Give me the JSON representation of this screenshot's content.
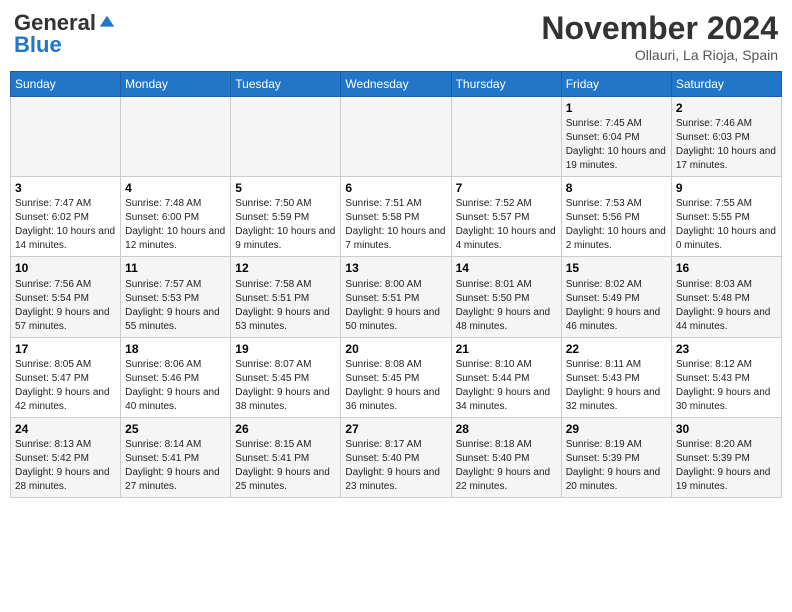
{
  "header": {
    "logo_general": "General",
    "logo_blue": "Blue",
    "month_title": "November 2024",
    "location": "Ollauri, La Rioja, Spain"
  },
  "weekdays": [
    "Sunday",
    "Monday",
    "Tuesday",
    "Wednesday",
    "Thursday",
    "Friday",
    "Saturday"
  ],
  "weeks": [
    [
      {
        "day": "",
        "info": ""
      },
      {
        "day": "",
        "info": ""
      },
      {
        "day": "",
        "info": ""
      },
      {
        "day": "",
        "info": ""
      },
      {
        "day": "",
        "info": ""
      },
      {
        "day": "1",
        "info": "Sunrise: 7:45 AM\nSunset: 6:04 PM\nDaylight: 10 hours and 19 minutes."
      },
      {
        "day": "2",
        "info": "Sunrise: 7:46 AM\nSunset: 6:03 PM\nDaylight: 10 hours and 17 minutes."
      }
    ],
    [
      {
        "day": "3",
        "info": "Sunrise: 7:47 AM\nSunset: 6:02 PM\nDaylight: 10 hours and 14 minutes."
      },
      {
        "day": "4",
        "info": "Sunrise: 7:48 AM\nSunset: 6:00 PM\nDaylight: 10 hours and 12 minutes."
      },
      {
        "day": "5",
        "info": "Sunrise: 7:50 AM\nSunset: 5:59 PM\nDaylight: 10 hours and 9 minutes."
      },
      {
        "day": "6",
        "info": "Sunrise: 7:51 AM\nSunset: 5:58 PM\nDaylight: 10 hours and 7 minutes."
      },
      {
        "day": "7",
        "info": "Sunrise: 7:52 AM\nSunset: 5:57 PM\nDaylight: 10 hours and 4 minutes."
      },
      {
        "day": "8",
        "info": "Sunrise: 7:53 AM\nSunset: 5:56 PM\nDaylight: 10 hours and 2 minutes."
      },
      {
        "day": "9",
        "info": "Sunrise: 7:55 AM\nSunset: 5:55 PM\nDaylight: 10 hours and 0 minutes."
      }
    ],
    [
      {
        "day": "10",
        "info": "Sunrise: 7:56 AM\nSunset: 5:54 PM\nDaylight: 9 hours and 57 minutes."
      },
      {
        "day": "11",
        "info": "Sunrise: 7:57 AM\nSunset: 5:53 PM\nDaylight: 9 hours and 55 minutes."
      },
      {
        "day": "12",
        "info": "Sunrise: 7:58 AM\nSunset: 5:51 PM\nDaylight: 9 hours and 53 minutes."
      },
      {
        "day": "13",
        "info": "Sunrise: 8:00 AM\nSunset: 5:51 PM\nDaylight: 9 hours and 50 minutes."
      },
      {
        "day": "14",
        "info": "Sunrise: 8:01 AM\nSunset: 5:50 PM\nDaylight: 9 hours and 48 minutes."
      },
      {
        "day": "15",
        "info": "Sunrise: 8:02 AM\nSunset: 5:49 PM\nDaylight: 9 hours and 46 minutes."
      },
      {
        "day": "16",
        "info": "Sunrise: 8:03 AM\nSunset: 5:48 PM\nDaylight: 9 hours and 44 minutes."
      }
    ],
    [
      {
        "day": "17",
        "info": "Sunrise: 8:05 AM\nSunset: 5:47 PM\nDaylight: 9 hours and 42 minutes."
      },
      {
        "day": "18",
        "info": "Sunrise: 8:06 AM\nSunset: 5:46 PM\nDaylight: 9 hours and 40 minutes."
      },
      {
        "day": "19",
        "info": "Sunrise: 8:07 AM\nSunset: 5:45 PM\nDaylight: 9 hours and 38 minutes."
      },
      {
        "day": "20",
        "info": "Sunrise: 8:08 AM\nSunset: 5:45 PM\nDaylight: 9 hours and 36 minutes."
      },
      {
        "day": "21",
        "info": "Sunrise: 8:10 AM\nSunset: 5:44 PM\nDaylight: 9 hours and 34 minutes."
      },
      {
        "day": "22",
        "info": "Sunrise: 8:11 AM\nSunset: 5:43 PM\nDaylight: 9 hours and 32 minutes."
      },
      {
        "day": "23",
        "info": "Sunrise: 8:12 AM\nSunset: 5:43 PM\nDaylight: 9 hours and 30 minutes."
      }
    ],
    [
      {
        "day": "24",
        "info": "Sunrise: 8:13 AM\nSunset: 5:42 PM\nDaylight: 9 hours and 28 minutes."
      },
      {
        "day": "25",
        "info": "Sunrise: 8:14 AM\nSunset: 5:41 PM\nDaylight: 9 hours and 27 minutes."
      },
      {
        "day": "26",
        "info": "Sunrise: 8:15 AM\nSunset: 5:41 PM\nDaylight: 9 hours and 25 minutes."
      },
      {
        "day": "27",
        "info": "Sunrise: 8:17 AM\nSunset: 5:40 PM\nDaylight: 9 hours and 23 minutes."
      },
      {
        "day": "28",
        "info": "Sunrise: 8:18 AM\nSunset: 5:40 PM\nDaylight: 9 hours and 22 minutes."
      },
      {
        "day": "29",
        "info": "Sunrise: 8:19 AM\nSunset: 5:39 PM\nDaylight: 9 hours and 20 minutes."
      },
      {
        "day": "30",
        "info": "Sunrise: 8:20 AM\nSunset: 5:39 PM\nDaylight: 9 hours and 19 minutes."
      }
    ]
  ]
}
